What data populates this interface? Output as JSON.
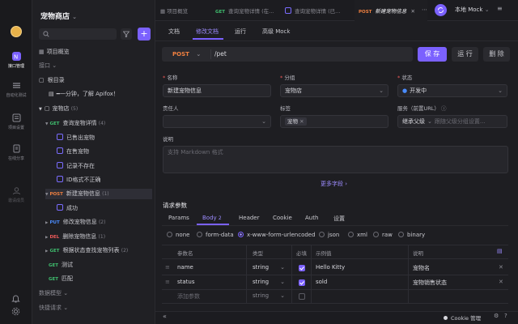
{
  "project": {
    "title": "宠物商店",
    "chevron": "⌄"
  },
  "rail": {
    "items": [
      {
        "label": "接口管理",
        "icon": "api-icon"
      },
      {
        "label": "自动化测试",
        "icon": "test-icon"
      },
      {
        "label": "项目设置",
        "icon": "settings-icon"
      },
      {
        "label": "在线分享",
        "icon": "share-icon"
      },
      {
        "label": "邀请成员",
        "icon": "invite-icon"
      }
    ]
  },
  "sidebar": {
    "search_placeholder": "",
    "overview": "项目概览",
    "section_api": "接口 ⌄",
    "root": "根目录",
    "promo": "━一分钟，了解 Apifox！",
    "folder": {
      "name": "宠物店",
      "count": "(5)"
    },
    "items": [
      {
        "method": "GET",
        "name": "查询宠物详情",
        "count": "(4)"
      },
      {
        "example": "已售出宠物"
      },
      {
        "example": "在售宠物"
      },
      {
        "example": "记录不存在"
      },
      {
        "example": "ID格式不正确"
      },
      {
        "method": "POST",
        "name": "新建宠物信息",
        "count": "(1)"
      },
      {
        "example": "成功"
      },
      {
        "method": "PUT",
        "name": "修改宠物信息",
        "count": "(2)"
      },
      {
        "method": "DEL",
        "name": "删除宠物信息",
        "count": "(1)"
      },
      {
        "method": "GET",
        "name": "根据状态查找宠物列表",
        "count": "(2)"
      },
      {
        "method": "GET",
        "name": "测试"
      },
      {
        "method": "GET",
        "name": "匹配"
      }
    ],
    "models": "数据模型 ⌄",
    "quick": "快捷请求 ⌄"
  },
  "tabs": [
    {
      "label": "项目概览"
    },
    {
      "method": "GET",
      "label": "查询宠物详情 (在..."
    },
    {
      "label": "查询宠物详情 (已..."
    },
    {
      "method": "POST",
      "label": "新建宠物信息"
    }
  ],
  "env": {
    "label": "本地 Mock"
  },
  "subtabs": [
    "文档",
    "修改文档",
    "运行",
    "高级 Mock"
  ],
  "request": {
    "method": "POST",
    "path": "/pet",
    "save": "保 存",
    "run": "运 行",
    "delete": "删 除"
  },
  "form": {
    "name_label": "名称",
    "name_value": "新建宠物信息",
    "group_label": "分组",
    "group_value": "宠物店",
    "status_label": "状态",
    "status_value": "开发中",
    "owner_label": "责任人",
    "tags_label": "标签",
    "tag": "宠物",
    "service_label": "服务（前置URL）",
    "service_value": "继承父级",
    "service_placeholder": "跟随父级分组设置...",
    "desc_label": "说明",
    "desc_placeholder": "支持 Markdown 格式",
    "more": "更多字段 ›"
  },
  "params": {
    "title": "请求参数",
    "tabs": [
      {
        "label": "Params"
      },
      {
        "label": "Body",
        "count": "2"
      },
      {
        "label": "Header"
      },
      {
        "label": "Cookie"
      },
      {
        "label": "Auth"
      },
      {
        "label": "设置"
      }
    ],
    "body_types": [
      "none",
      "form-data",
      "x-www-form-urlencoded",
      "json",
      "xml",
      "raw",
      "binary"
    ],
    "selected_body": "x-www-form-urlencoded",
    "columns": [
      "参数名",
      "类型",
      "必填",
      "示例值",
      "说明"
    ],
    "rows": [
      {
        "name": "name",
        "type": "string",
        "required": true,
        "example": "Hello Kitty",
        "desc": "宠物名"
      },
      {
        "name": "status",
        "type": "string",
        "required": true,
        "example": "sold",
        "desc": "宠物销售状态"
      }
    ],
    "add_placeholder": "添加参数",
    "add_type": "string"
  },
  "statusbar": {
    "collapse": "«",
    "cookie": "Cookie 管理"
  }
}
